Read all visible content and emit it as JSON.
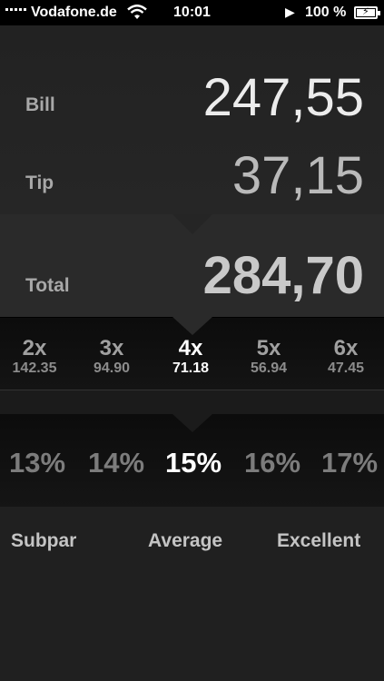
{
  "status_bar": {
    "carrier": "Vodafone.de",
    "time": "10:01",
    "battery": "100 %"
  },
  "amounts": {
    "bill_label": "Bill",
    "bill_value": "247,55",
    "tip_label": "Tip",
    "tip_value": "37,15",
    "total_label": "Total",
    "total_value": "284,70"
  },
  "split": {
    "options": [
      {
        "multiplier": "2x",
        "amount": "142.35"
      },
      {
        "multiplier": "3x",
        "amount": "94.90"
      },
      {
        "multiplier": "4x",
        "amount": "71.18"
      },
      {
        "multiplier": "5x",
        "amount": "56.94"
      },
      {
        "multiplier": "6x",
        "amount": "47.45"
      }
    ],
    "selected": "4x"
  },
  "tip_percent": {
    "options": [
      "13%",
      "14%",
      "15%",
      "16%",
      "17%"
    ],
    "selected": "15%"
  },
  "ratings": {
    "low": "Subpar",
    "mid": "Average",
    "high": "Excellent"
  }
}
